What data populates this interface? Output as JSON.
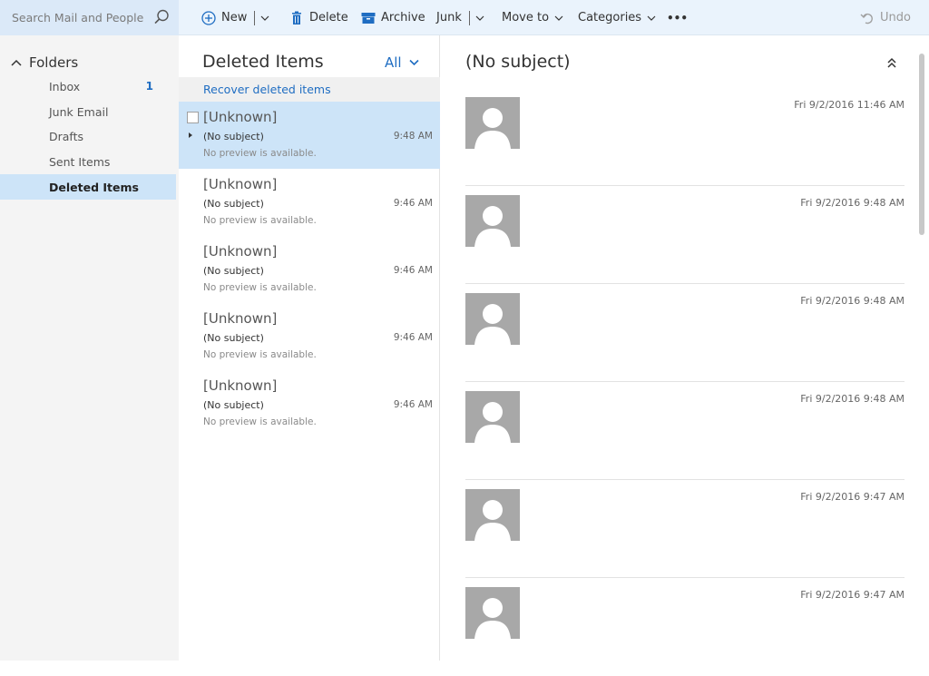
{
  "search": {
    "placeholder": "Search Mail and People"
  },
  "toolbar": {
    "new_label": "New",
    "delete_label": "Delete",
    "archive_label": "Archive",
    "junk_label": "Junk",
    "move_to_label": "Move to",
    "categories_label": "Categories",
    "more_label": "•••",
    "undo_label": "Undo"
  },
  "sidebar": {
    "header": "Folders",
    "items": [
      {
        "label": "Inbox",
        "count": "1"
      },
      {
        "label": "Junk Email",
        "count": ""
      },
      {
        "label": "Drafts",
        "count": ""
      },
      {
        "label": "Sent Items",
        "count": ""
      },
      {
        "label": "Deleted Items",
        "count": ""
      }
    ],
    "selected_index": 4
  },
  "list": {
    "title": "Deleted Items",
    "filter": "All",
    "recover_link": "Recover deleted items",
    "messages": [
      {
        "sender": "[Unknown]",
        "subject": "(No subject)",
        "time": "9:48 AM",
        "preview": "No preview is available."
      },
      {
        "sender": "[Unknown]",
        "subject": "(No subject)",
        "time": "9:46 AM",
        "preview": "No preview is available."
      },
      {
        "sender": "[Unknown]",
        "subject": "(No subject)",
        "time": "9:46 AM",
        "preview": "No preview is available."
      },
      {
        "sender": "[Unknown]",
        "subject": "(No subject)",
        "time": "9:46 AM",
        "preview": "No preview is available."
      },
      {
        "sender": "[Unknown]",
        "subject": "(No subject)",
        "time": "9:46 AM",
        "preview": "No preview is available."
      }
    ],
    "selected_index": 0
  },
  "reading": {
    "title": "(No subject)",
    "items": [
      {
        "date": "Fri 9/2/2016 11:46 AM"
      },
      {
        "date": "Fri 9/2/2016 9:48 AM"
      },
      {
        "date": "Fri 9/2/2016 9:48 AM"
      },
      {
        "date": "Fri 9/2/2016 9:48 AM"
      },
      {
        "date": "Fri 9/2/2016 9:47 AM"
      },
      {
        "date": "Fri 9/2/2016 9:47 AM"
      }
    ]
  },
  "colors": {
    "accent": "#1f6dc2",
    "selection": "#cde4f8",
    "topbar": "#eaf3fc",
    "avatar": "#a8a8a8"
  }
}
